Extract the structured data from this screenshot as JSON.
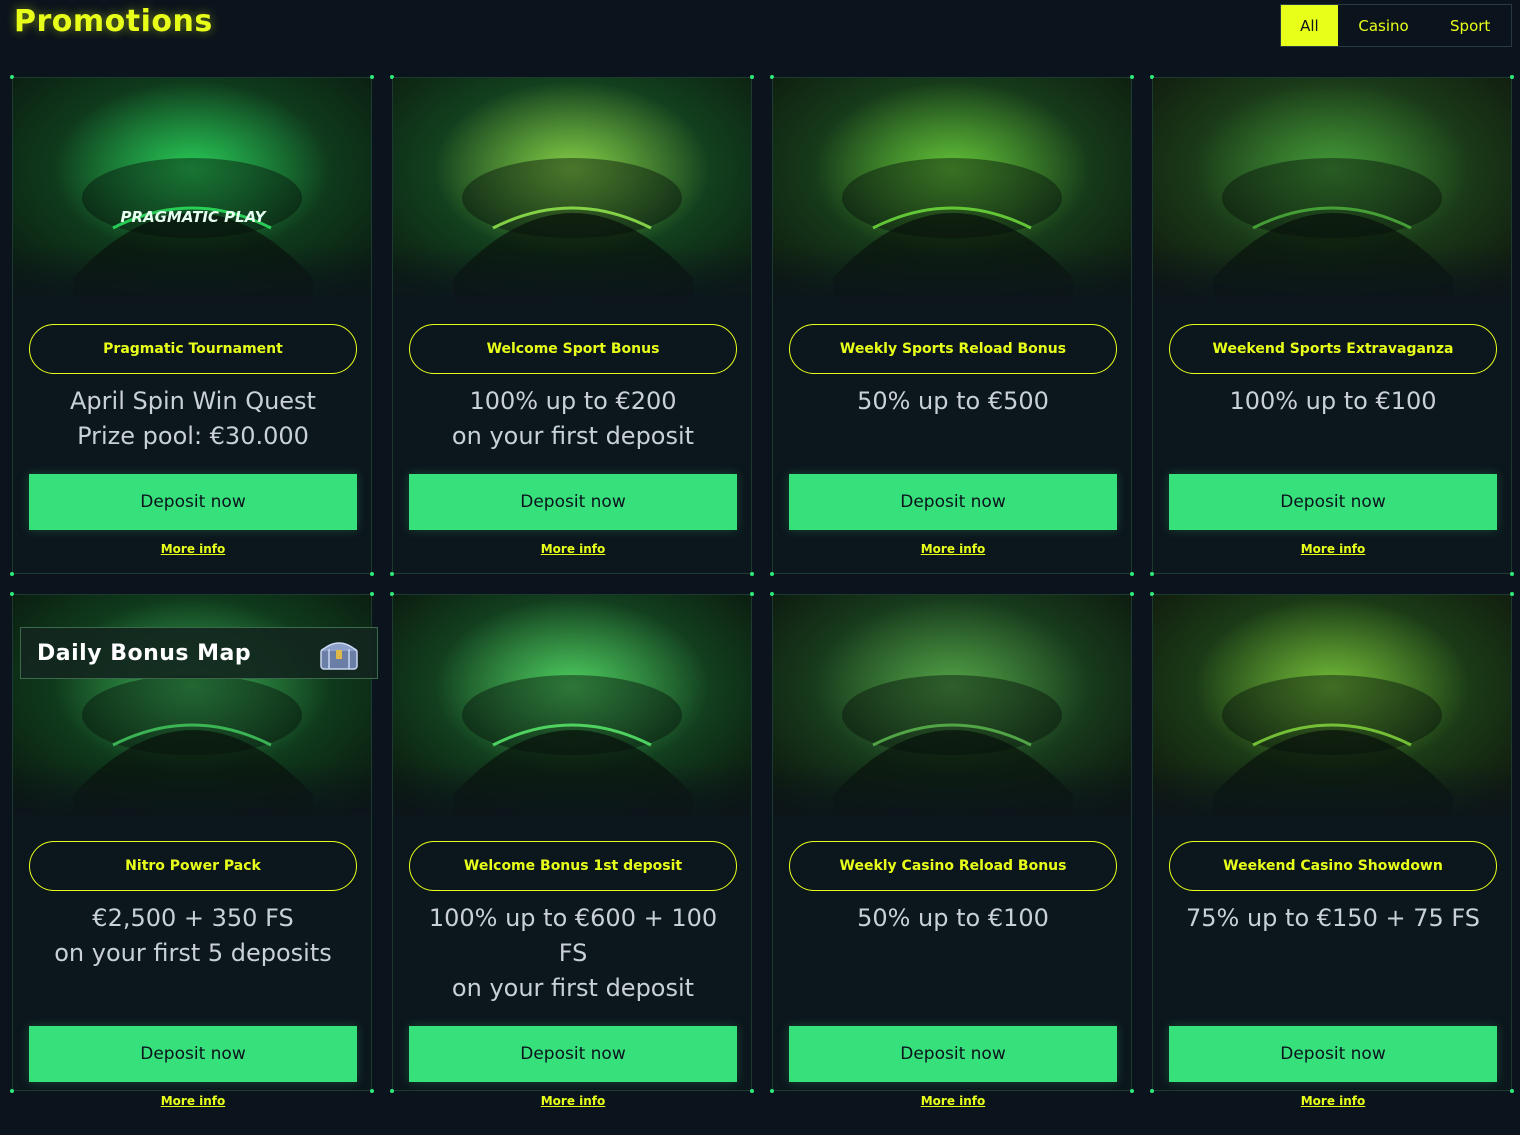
{
  "header": {
    "title": "Promotions",
    "filters": [
      {
        "label": "All",
        "active": true
      },
      {
        "label": "Casino",
        "active": false
      },
      {
        "label": "Sport",
        "active": false
      }
    ]
  },
  "colors": {
    "accent_yellow": "#e8ff1a",
    "accent_green": "#36e07a",
    "background": "#0b141c"
  },
  "cards": [
    {
      "image": "pragmatic-car-image",
      "image_text": "PRAGMATIC PLAY",
      "tag": "Pragmatic Tournament",
      "desc": "April Spin Win Quest\nPrize pool: €30.000",
      "button": "Deposit now",
      "link": "More info"
    },
    {
      "image": "cheering-player-image",
      "tag": "Welcome Sport Bonus",
      "desc": "100% up to €200\non your first deposit",
      "button": "Deposit now",
      "link": "More info"
    },
    {
      "image": "celebrating-players-image",
      "tag": "Weekly Sports Reload Bonus",
      "desc": "50% up to €500",
      "button": "Deposit now",
      "link": "More info"
    },
    {
      "image": "football-players-image",
      "tag": "Weekend Sports Extravaganza",
      "desc": "100% up to €100",
      "button": "Deposit now",
      "link": "More info"
    },
    {
      "image": "nitro-car-image",
      "tag": "Nitro Power Pack",
      "desc": "€2,500 + 350 FS\non your first 5 deposits",
      "button": "Deposit now",
      "link": "More info"
    },
    {
      "image": "futuristic-car-image",
      "tag": "Welcome Bonus 1st deposit",
      "desc": "100% up to €600 + 100\nFS\non your first deposit",
      "button": "Deposit now",
      "link": "More info"
    },
    {
      "image": "forest-car-image",
      "tag": "Weekly Casino Reload Bonus",
      "desc": "50% up to €100",
      "button": "Deposit now",
      "link": "More info"
    },
    {
      "image": "supercar-image",
      "tag": "Weekend Casino Showdown",
      "desc": "75% up to €150 + 75 FS",
      "button": "Deposit now",
      "link": "More info"
    }
  ],
  "daily_bonus": {
    "label": "Daily Bonus Map",
    "icon": "treasure-chest-icon"
  }
}
